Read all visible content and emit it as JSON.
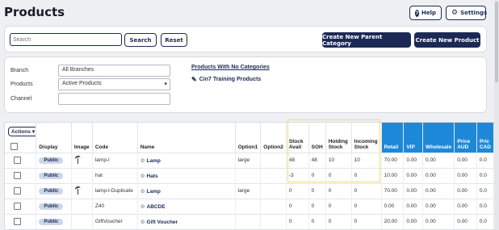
{
  "page": {
    "title": "Products"
  },
  "header": {
    "help_label": "Help",
    "settings_label": "Settings"
  },
  "search": {
    "placeholder": "Search",
    "search_label": "Search",
    "reset_label": "Reset"
  },
  "actions": {
    "new_parent_category": "Create New Parent Category",
    "new_product": "Create New Product"
  },
  "filters": {
    "branch_label": "Branch",
    "branch_value": "All Branches",
    "products_label": "Products",
    "products_value": "Active Products",
    "channel_label": "Channel",
    "channel_value": "",
    "link_no_categories": "Products With No Categories",
    "link_training": "Cin7 Training Products"
  },
  "table": {
    "actions_label": "Actions",
    "columns": {
      "display": "Display",
      "image": "Image",
      "code": "Code",
      "name": "Name",
      "option1": "Option1",
      "option2": "Option2",
      "stock_avail_1": "Stock",
      "stock_avail_2": "Avail",
      "soh": "SOH",
      "holding_1": "Holding",
      "holding_2": "Stock",
      "incoming_1": "Incoming",
      "incoming_2": "Stock",
      "retail": "Retail",
      "vip": "VIP",
      "wholesale": "Wholesale",
      "price_aud_1": "Price",
      "price_aud_2": "AUD",
      "price_cad_1": "Pric",
      "price_cad_2": "CAD"
    },
    "rows": [
      {
        "display": "Public",
        "image": "lamp",
        "code": "lamp-l",
        "name": "Lamp",
        "option1": "large",
        "option2": "",
        "stock_avail": "48",
        "soh": "48",
        "holding": "10",
        "incoming": "10",
        "retail": "70.00",
        "vip": "0.00",
        "wholesale": "0.00",
        "price_aud": "0.00",
        "price_cad": "0.0"
      },
      {
        "display": "Public",
        "image": "",
        "code": "hat",
        "name": "Hats",
        "option1": "",
        "option2": "",
        "stock_avail": "-3",
        "soh": "0",
        "holding": "0",
        "incoming": "0",
        "retail": "10.00",
        "vip": "0.00",
        "wholesale": "0.00",
        "price_aud": "0.00",
        "price_cad": "0.0"
      },
      {
        "display": "Public",
        "image": "lamp",
        "code": "lamp-l-Duplicate",
        "name": "Lamp",
        "option1": "large",
        "option2": "",
        "stock_avail": "0",
        "soh": "0",
        "holding": "0",
        "incoming": "0",
        "retail": "70.00",
        "vip": "0.00",
        "wholesale": "0.00",
        "price_aud": "0.00",
        "price_cad": "0.0"
      },
      {
        "display": "Public",
        "image": "",
        "code": "Z40",
        "name": "ABCDE",
        "option1": "",
        "option2": "",
        "stock_avail": "0",
        "soh": "0",
        "holding": "0",
        "incoming": "0",
        "retail": "0.00",
        "vip": "0.00",
        "wholesale": "0.00",
        "price_aud": "0.00",
        "price_cad": "0.0"
      },
      {
        "display": "Public",
        "image": "",
        "code": "GiftVoucher",
        "name": "Gift Voucher",
        "option1": "",
        "option2": "",
        "stock_avail": "0",
        "soh": "0",
        "holding": "0",
        "incoming": "0",
        "retail": "20.00",
        "vip": "0.00",
        "wholesale": "0.00",
        "price_aud": "0.00",
        "price_cad": "0.0"
      }
    ]
  },
  "colors": {
    "navy": "#1b2a55",
    "blue_header": "#1e88d8",
    "highlight": "#f0dc7a"
  }
}
